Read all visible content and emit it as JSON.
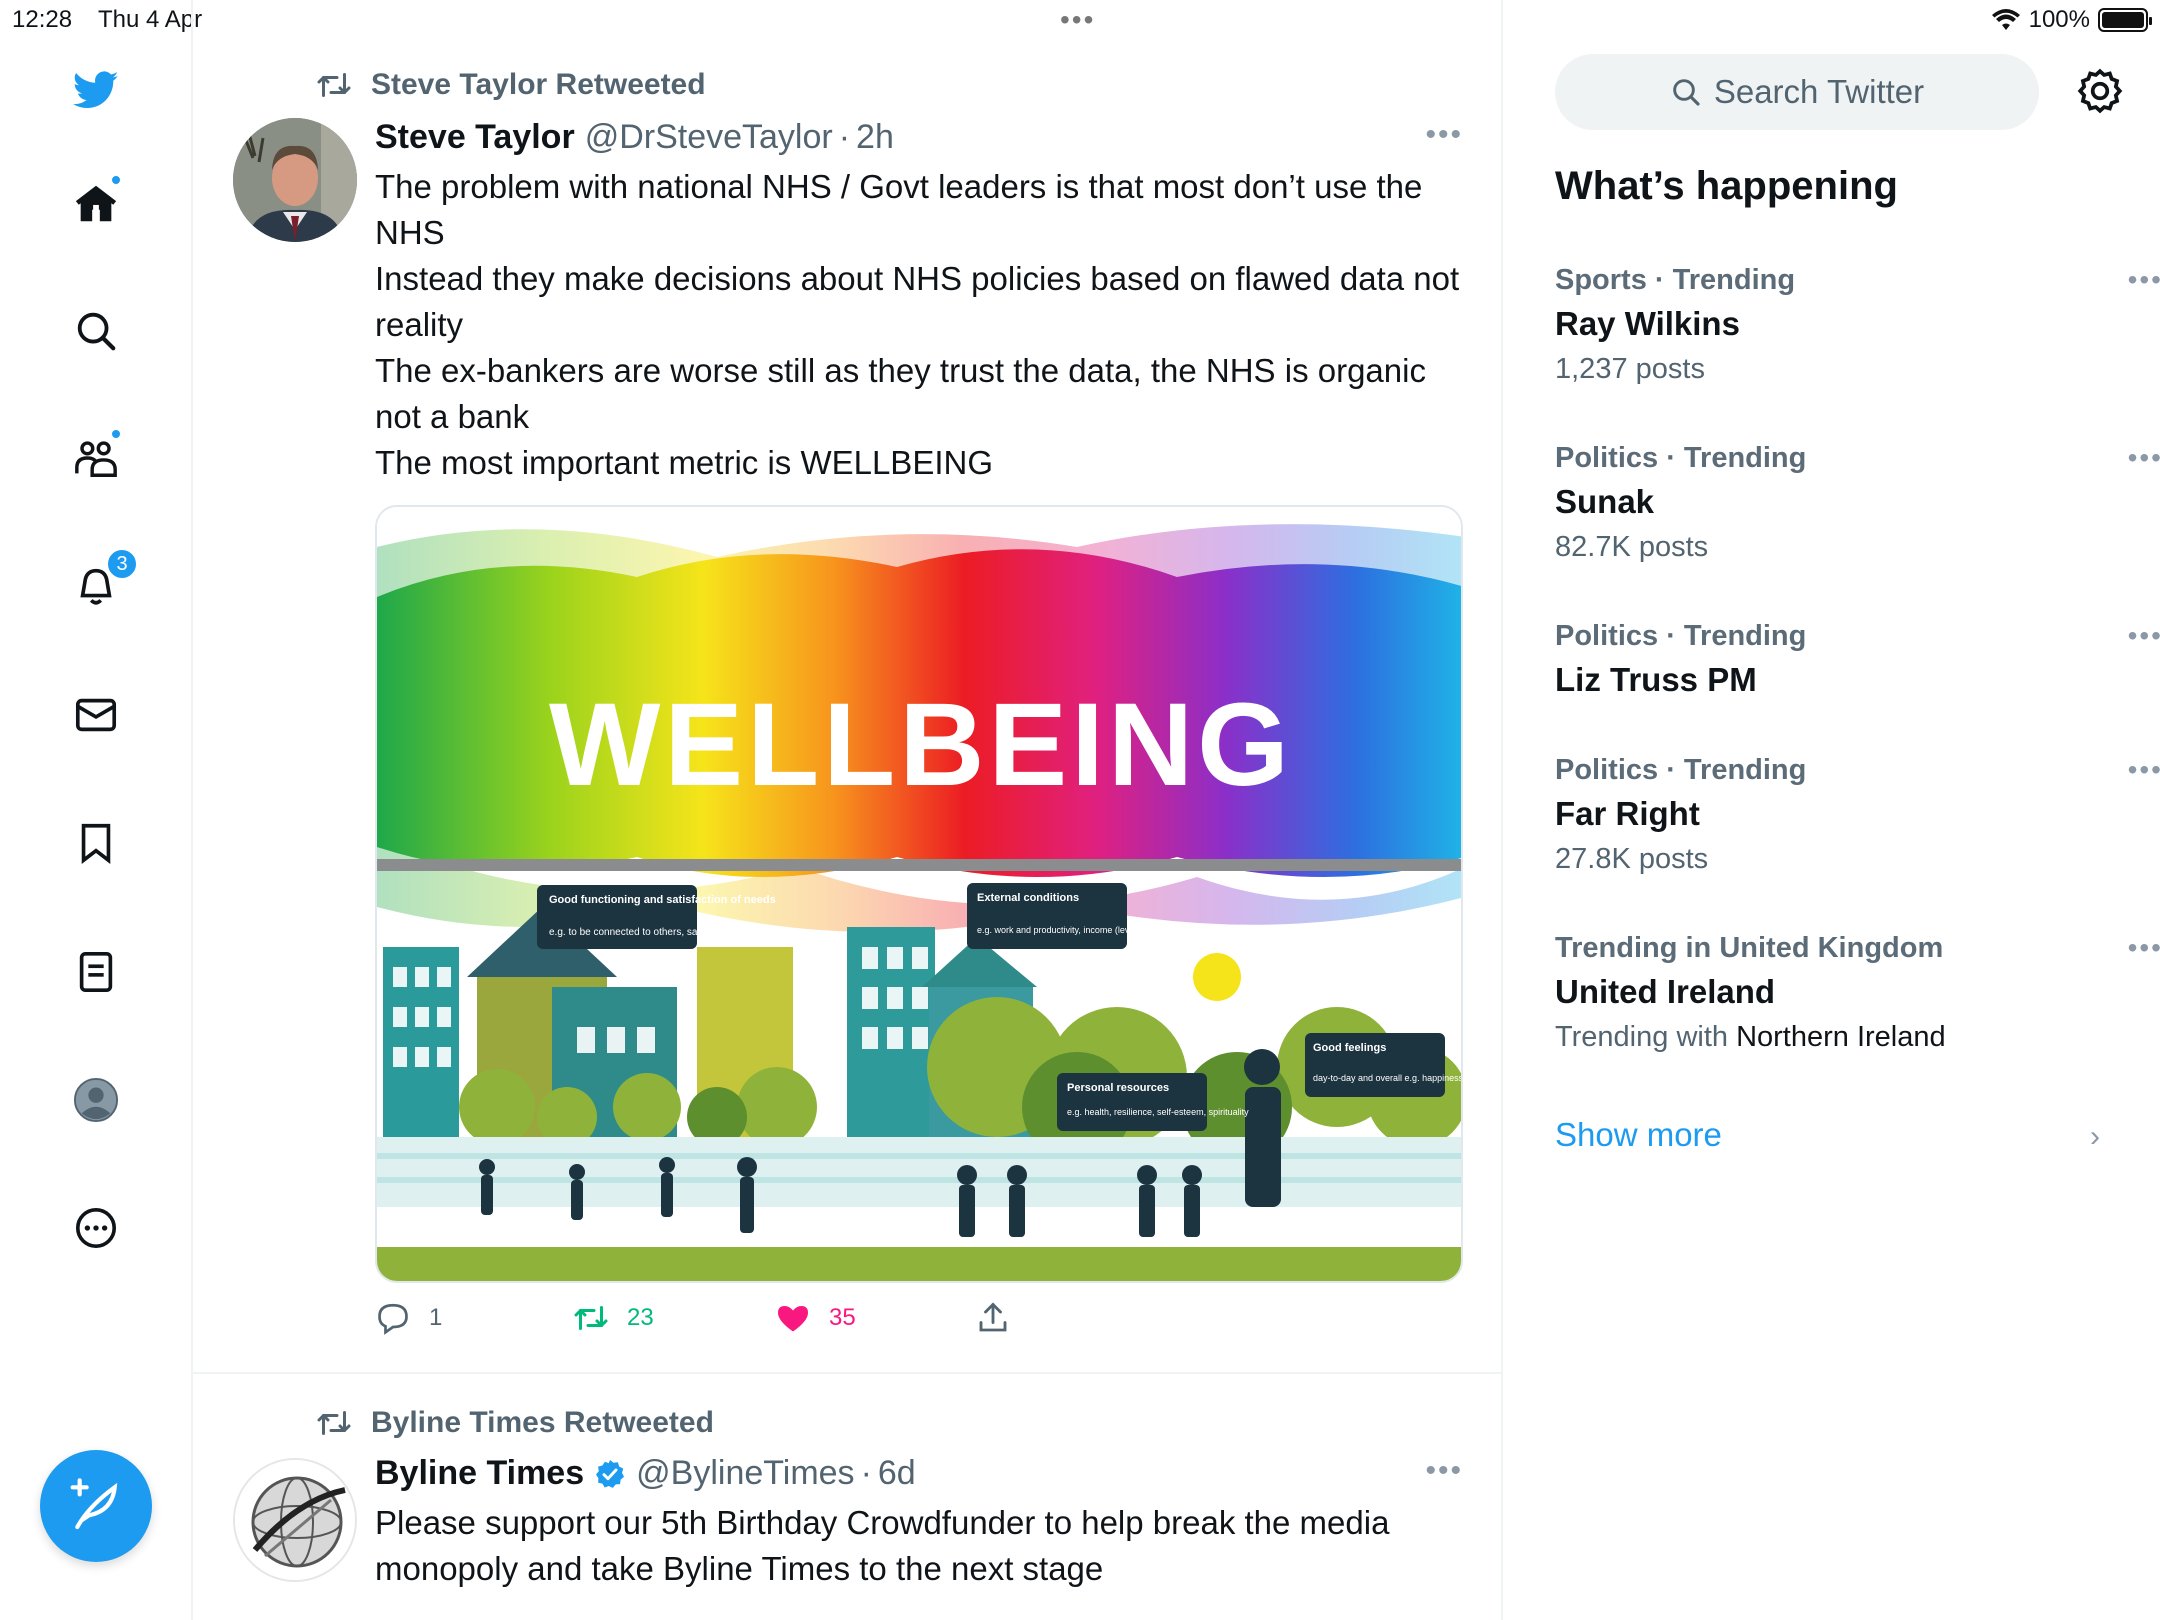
{
  "status_bar": {
    "time": "12:28",
    "date": "Thu 4 Apr",
    "battery": "100%"
  },
  "nav": {
    "notifications_badge": "3"
  },
  "tweets": [
    {
      "retweeted_by": "Steve Taylor Retweeted",
      "name": "Steve Taylor",
      "handle": "@DrSteveTaylor",
      "time": "2h",
      "lines": [
        "The problem with national NHS / Govt leaders is that most don’t use the NHS",
        "Instead they make decisions about NHS policies based on flawed data not reality",
        "The ex-bankers are worse still as they trust the data, the NHS is organic not a bank",
        "The most important metric is WELLBEING"
      ],
      "media": {
        "headline": "WELLBEING",
        "callouts": [
          {
            "title": "Good functioning and satisfaction of needs",
            "body": "e.g. to be connected to others, safe, autonomous"
          },
          {
            "title": "External conditions",
            "body": "e.g. work and productivity, income (levels and stability), housing, environment"
          },
          {
            "title": "Good feelings",
            "body": "day-to-day and overall e.g. happiness, joy, satisfaction"
          },
          {
            "title": "Personal resources",
            "body": "e.g. health, resilience, self-esteem, spirituality"
          }
        ]
      },
      "replies": "1",
      "retweets": "23",
      "likes": "35"
    },
    {
      "retweeted_by": "Byline Times Retweeted",
      "name": "Byline Times",
      "handle": "@BylineTimes",
      "time": "6d",
      "lines": [
        "Please support our 5th Birthday Crowdfunder to help break the media monopoly and take Byline Times to the next stage"
      ]
    }
  ],
  "search": {
    "placeholder": "Search Twitter"
  },
  "whats_happening": {
    "title": "What’s happening",
    "trends": [
      {
        "category": "Sports · Trending",
        "name": "Ray Wilkins",
        "count": "1,237 posts"
      },
      {
        "category": "Politics · Trending",
        "name": "Sunak",
        "count": "82.7K posts"
      },
      {
        "category": "Politics · Trending",
        "name": "Liz Truss PM",
        "count": ""
      },
      {
        "category": "Politics · Trending",
        "name": "Far Right",
        "count": "27.8K posts"
      },
      {
        "category": "Trending in United Kingdom",
        "name": "United Ireland",
        "count_prefix": "Trending with ",
        "count_strong": "Northern Ireland"
      }
    ],
    "show_more": "Show more"
  },
  "colors": {
    "accent": "#1d9bf0",
    "retweet_green": "#00ba7c",
    "like_pink": "#f91880",
    "muted": "#536471"
  }
}
